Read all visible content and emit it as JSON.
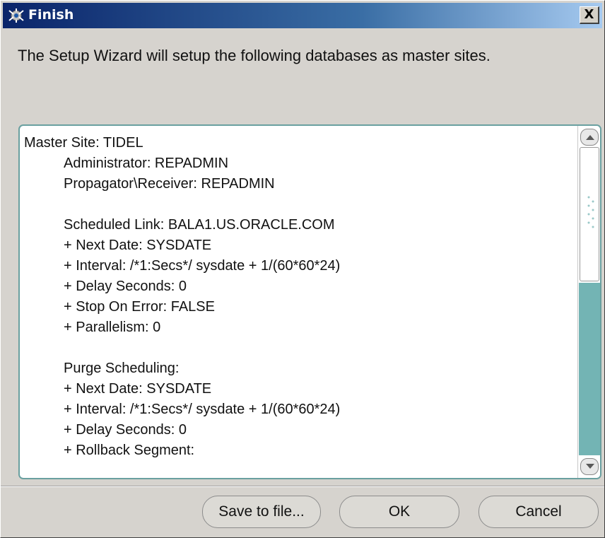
{
  "window": {
    "title": "Finish",
    "title_icon": "wizard-icon",
    "close_label": "X",
    "titlebar_colors": [
      "#0a246a",
      "#a6caf0"
    ]
  },
  "intro_text": "The Setup Wizard will setup the following databases as master sites.",
  "summary": {
    "lines": [
      {
        "text": "Master Site: TIDEL",
        "indent": false
      },
      {
        "text": "Administrator: REPADMIN",
        "indent": true
      },
      {
        "text": "Propagator\\Receiver: REPADMIN",
        "indent": true
      },
      {
        "text": "",
        "indent": true
      },
      {
        "text": "Scheduled Link: BALA1.US.ORACLE.COM",
        "indent": true
      },
      {
        "text": "+ Next Date: SYSDATE",
        "indent": true
      },
      {
        "text": "+ Interval: /*1:Secs*/ sysdate + 1/(60*60*24)",
        "indent": true
      },
      {
        "text": "+ Delay Seconds: 0",
        "indent": true
      },
      {
        "text": "+ Stop On Error: FALSE",
        "indent": true
      },
      {
        "text": "+ Parallelism: 0",
        "indent": true
      },
      {
        "text": "",
        "indent": true
      },
      {
        "text": "Purge Scheduling:",
        "indent": true
      },
      {
        "text": "+ Next Date: SYSDATE",
        "indent": true
      },
      {
        "text": "+ Interval: /*1:Secs*/ sysdate + 1/(60*60*24)",
        "indent": true
      },
      {
        "text": "+ Delay Seconds: 0",
        "indent": true
      },
      {
        "text": "+ Rollback Segment:",
        "indent": true
      }
    ],
    "scroll_accent": "#73b4b4"
  },
  "buttons": {
    "save": "Save to file...",
    "ok": "OK",
    "cancel": "Cancel"
  }
}
